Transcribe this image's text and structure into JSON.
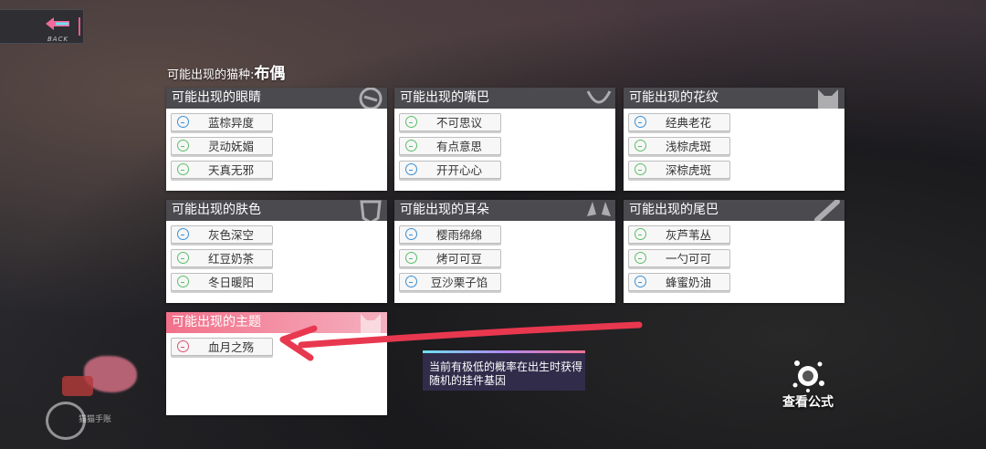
{
  "back": {
    "label": "BACK"
  },
  "breed": {
    "label": "可能出现的猫种:",
    "value": "布偶"
  },
  "panels": {
    "eyes": {
      "title": "可能出现的眼睛",
      "items": [
        {
          "label": "蓝棕异度",
          "color": "blue"
        },
        {
          "label": "灵动妩媚",
          "color": "green"
        },
        {
          "label": "天真无邪",
          "color": "green"
        }
      ]
    },
    "mouth": {
      "title": "可能出现的嘴巴",
      "items": [
        {
          "label": "不可思议",
          "color": "green"
        },
        {
          "label": "有点意思",
          "color": "green"
        },
        {
          "label": "开开心心",
          "color": "blue"
        }
      ]
    },
    "pattern": {
      "title": "可能出现的花纹",
      "items": [
        {
          "label": "经典老花",
          "color": "blue"
        },
        {
          "label": "浅棕虎斑",
          "color": "green"
        },
        {
          "label": "深棕虎斑",
          "color": "green"
        }
      ]
    },
    "skin": {
      "title": "可能出现的肤色",
      "items": [
        {
          "label": "灰色深空",
          "color": "blue"
        },
        {
          "label": "红豆奶茶",
          "color": "green"
        },
        {
          "label": "冬日暖阳",
          "color": "green"
        }
      ]
    },
    "ears": {
      "title": "可能出现的耳朵",
      "items": [
        {
          "label": "樱雨绵绵",
          "color": "blue"
        },
        {
          "label": "烤可可豆",
          "color": "green"
        },
        {
          "label": "豆沙栗子馅",
          "color": "blue"
        }
      ]
    },
    "tail": {
      "title": "可能出现的尾巴",
      "items": [
        {
          "label": "灰芦苇丛",
          "color": "green"
        },
        {
          "label": "一勺可可",
          "color": "green"
        },
        {
          "label": "蜂蜜奶油",
          "color": "blue"
        }
      ]
    },
    "theme": {
      "title": "可能出现的主题",
      "items": [
        {
          "label": "血月之殇",
          "color": "pink"
        }
      ]
    }
  },
  "tip": {
    "text": "当前有极低的概率在出生时获得随机的挂件基因"
  },
  "formula": {
    "label": "查看公式"
  },
  "emblem": {
    "text": "猫猫手账"
  },
  "colors": {
    "panel_header": "#4a4a4f",
    "theme_header": "#f2708a",
    "arrow": "#e8384f",
    "blue": "#3a8fd6",
    "green": "#5bbf6a"
  }
}
